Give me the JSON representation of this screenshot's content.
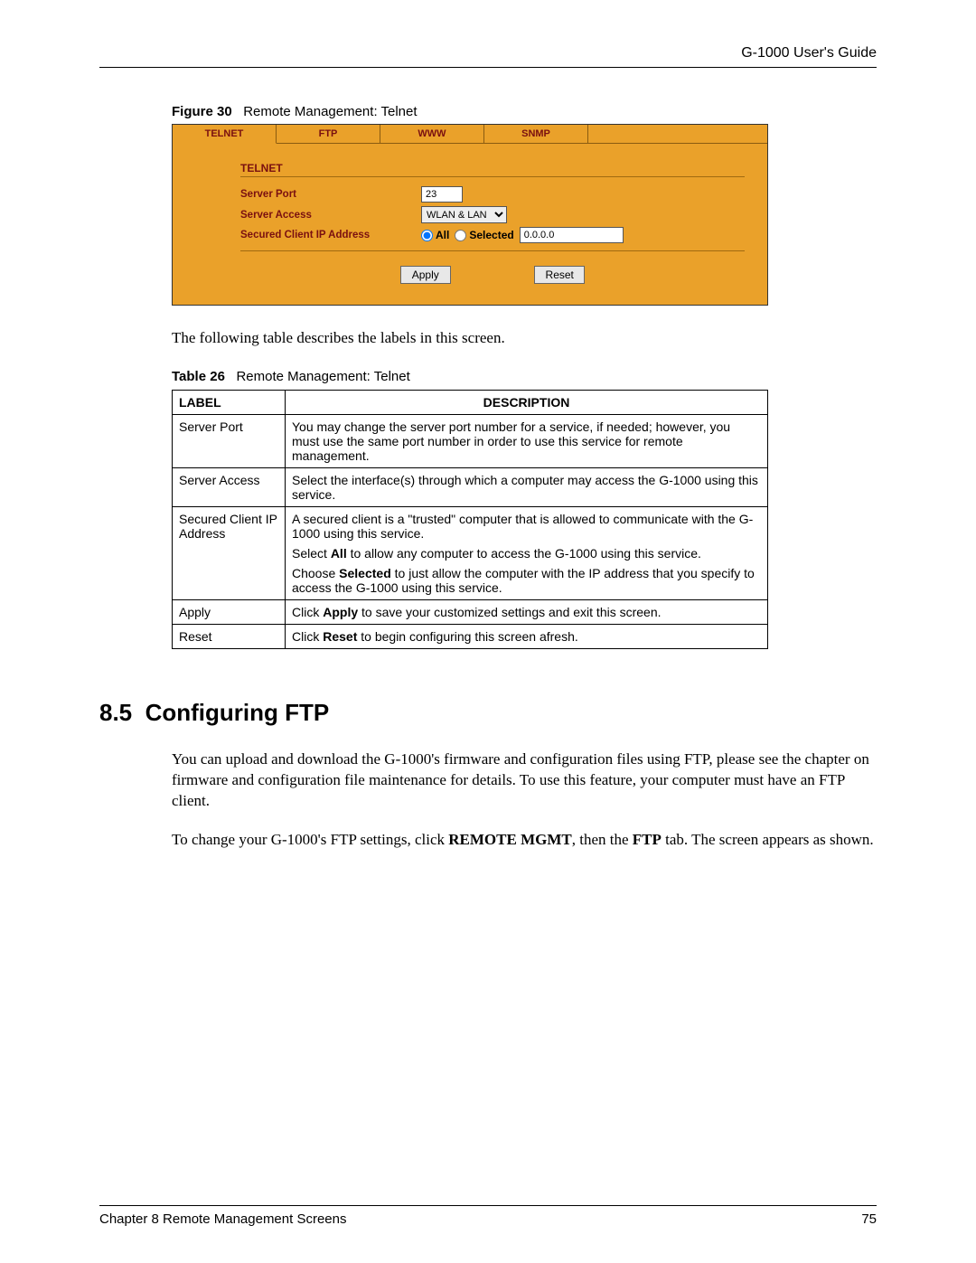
{
  "header": {
    "guide_title": "G-1000 User's Guide"
  },
  "figure": {
    "label": "Figure 30",
    "title": "Remote Management: Telnet"
  },
  "ui": {
    "tabs": [
      "TELNET",
      "FTP",
      "WWW",
      "SNMP"
    ],
    "section_title": "TELNET",
    "rows": {
      "server_port": {
        "label": "Server Port",
        "value": "23"
      },
      "server_access": {
        "label": "Server Access",
        "value": "WLAN & LAN"
      },
      "secured_ip": {
        "label": "Secured Client IP Address",
        "radio_all": "All",
        "radio_selected": "Selected",
        "ip_value": "0.0.0.0"
      }
    },
    "buttons": {
      "apply": "Apply",
      "reset": "Reset"
    }
  },
  "intro_text": "The following table describes the labels in this screen.",
  "table": {
    "label": "Table 26",
    "title": "Remote Management: Telnet",
    "head_label": "LABEL",
    "head_desc": "DESCRIPTION",
    "rows": [
      {
        "label": "Server Port",
        "desc": [
          "You may change the server port number for a service, if needed; however, you must use the same port number in order to use this service for remote management."
        ]
      },
      {
        "label": "Server Access",
        "desc": [
          "Select the interface(s) through which a computer may access the G-1000 using this service."
        ]
      },
      {
        "label": "Secured Client IP Address",
        "desc": [
          "A secured client is a \"trusted\" computer that is allowed to communicate with the G-1000 using this service.",
          "Select <b>All</b> to allow any computer to access the G-1000 using this service.",
          "Choose <b>Selected</b> to just allow the computer with the IP address that you specify to access the G-1000 using this service."
        ]
      },
      {
        "label": "Apply",
        "desc": [
          "Click <b>Apply</b> to save your customized settings and exit this screen."
        ]
      },
      {
        "label": "Reset",
        "desc": [
          "Click <b>Reset</b> to begin configuring this screen afresh."
        ]
      }
    ]
  },
  "section": {
    "number": "8.5",
    "title": "Configuring FTP",
    "para1": "You can upload and download the G-1000's firmware and configuration files using FTP, please see the chapter on firmware and configuration file maintenance for details. To use this feature, your computer must have an FTP client.",
    "para2_pre": "To change your G-1000's FTP settings, click ",
    "para2_b1": "REMOTE MGMT",
    "para2_mid": ", then the ",
    "para2_b2": "FTP",
    "para2_post": " tab. The screen appears as shown."
  },
  "footer": {
    "chapter": "Chapter 8 Remote Management Screens",
    "page": "75"
  }
}
